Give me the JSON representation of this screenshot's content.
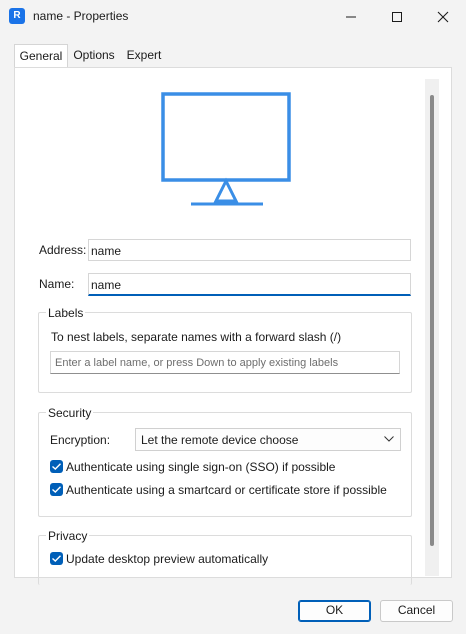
{
  "window": {
    "title": "name - Properties",
    "app_icon_glyph": "R"
  },
  "tabs": [
    {
      "label": "General",
      "active": true
    },
    {
      "label": "Options",
      "active": false
    },
    {
      "label": "Expert",
      "active": false
    }
  ],
  "general": {
    "address_label": "Address:",
    "address_value": "name",
    "name_label": "Name:",
    "name_value": "name"
  },
  "labels_group": {
    "legend": "Labels",
    "hint": "To nest labels, separate names with a forward slash (/)",
    "input_placeholder": "Enter a label name, or press Down to apply existing labels"
  },
  "security_group": {
    "legend": "Security",
    "encryption_label": "Encryption:",
    "encryption_value": "Let the remote device choose",
    "sso_label": "Authenticate using single sign-on (SSO) if possible",
    "sso_checked": true,
    "smartcard_label": "Authenticate using a smartcard or certificate store if possible",
    "smartcard_checked": true
  },
  "privacy_group": {
    "legend": "Privacy",
    "preview_label": "Update desktop preview automatically",
    "preview_checked": true
  },
  "footer": {
    "ok_label": "OK",
    "cancel_label": "Cancel"
  },
  "colors": {
    "accent": "#005fb8",
    "monitor_icon": "#3a8ee6"
  }
}
